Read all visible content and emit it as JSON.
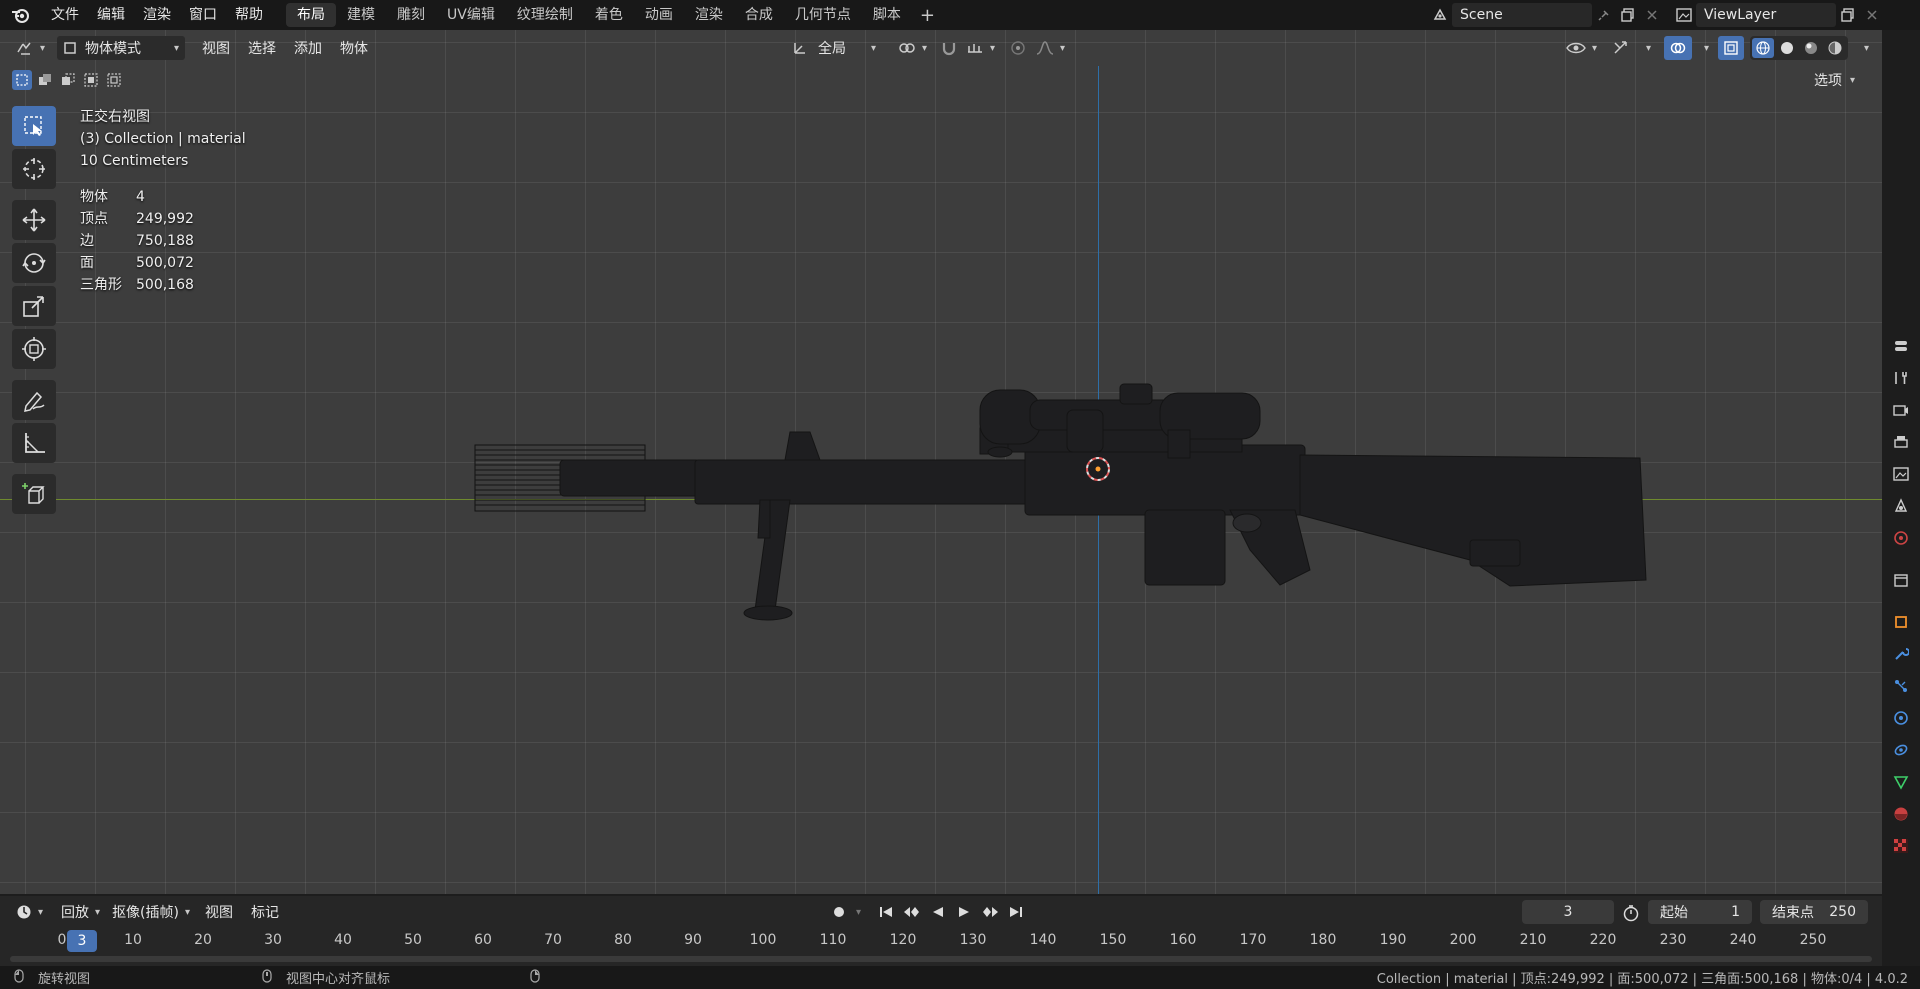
{
  "topbar": {
    "menus": [
      "文件",
      "编辑",
      "渲染",
      "窗口",
      "帮助"
    ],
    "workspaces": [
      "布局",
      "建模",
      "雕刻",
      "UV编辑",
      "纹理绘制",
      "着色",
      "动画",
      "渲染",
      "合成",
      "几何节点",
      "脚本"
    ],
    "active_workspace": "布局",
    "add_workspace": "+",
    "scene": "Scene",
    "view_layer": "ViewLayer"
  },
  "viewport_header": {
    "mode": "物体模式",
    "menus": [
      "视图",
      "选择",
      "添加",
      "物体"
    ],
    "transform_orientation": "全局",
    "options": "选项"
  },
  "overlay": {
    "view_name": "正交右视图",
    "collection": "(3) Collection | material",
    "scale": "10 Centimeters",
    "stats": [
      {
        "label": "物体",
        "value": "4"
      },
      {
        "label": "顶点",
        "value": "249,992"
      },
      {
        "label": "边",
        "value": "750,188"
      },
      {
        "label": "面",
        "value": "500,072"
      },
      {
        "label": "三角形",
        "value": "500,168"
      }
    ]
  },
  "toolbar_icons": [
    "select-box-icon",
    "cursor-icon",
    "move-icon",
    "rotate-icon",
    "scale-icon",
    "transform-icon",
    "annotate-icon",
    "measure-icon",
    "add-cube-icon"
  ],
  "timeline": {
    "menus": [
      "回放",
      "抠像(插帧)",
      "视图",
      "标记"
    ],
    "current_frame": "3",
    "start_label": "起始",
    "start": "1",
    "end_label": "结束点",
    "end": "250",
    "ruler": [
      "0",
      "10",
      "20",
      "30",
      "40",
      "50",
      "60",
      "70",
      "80",
      "90",
      "100",
      "110",
      "120",
      "130",
      "140",
      "150",
      "160",
      "170",
      "180",
      "190",
      "200",
      "210",
      "220",
      "230",
      "240",
      "250"
    ]
  },
  "statusbar": {
    "left_hint": "旋转视图",
    "middle_hint": "视图中心对齐鼠标",
    "info": "Collection | material | 顶点:249,992 | 面:500,072 | 三角面:500,168 | 物体:0/4 | 4.0.2"
  },
  "colors": {
    "accent": "#4772b3",
    "axis_x": "#6f8a2e",
    "axis_z": "#2e6fa8",
    "viewport_bg": "#3d3d3d"
  }
}
